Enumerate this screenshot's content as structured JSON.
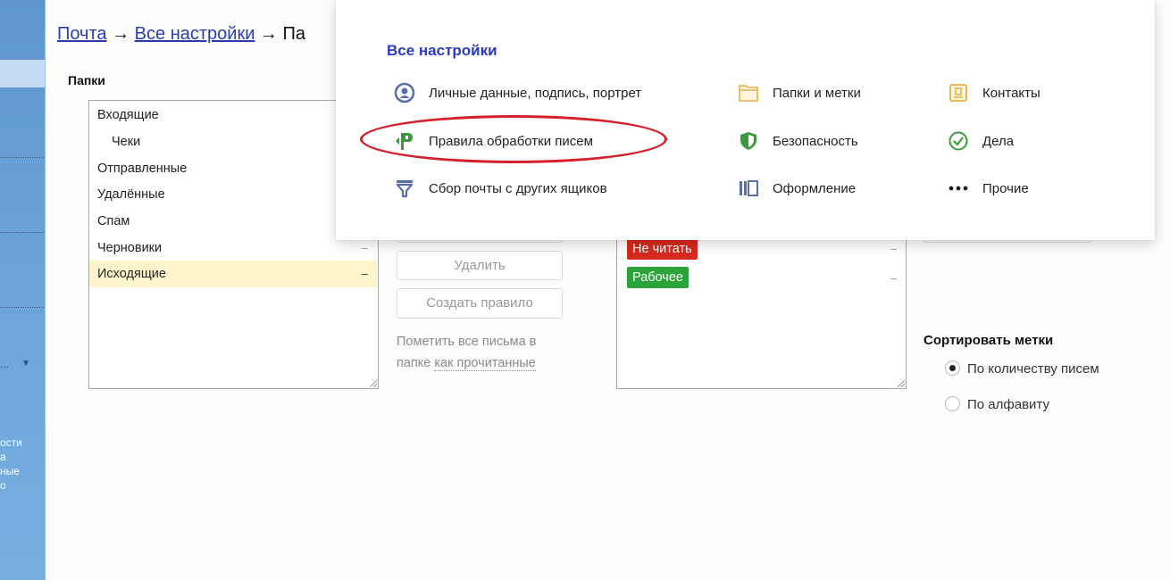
{
  "sidebar": {
    "texts": [
      "...",
      "ости",
      "а",
      "ные",
      "о"
    ],
    "dropdown_icon": "triangle-down-icon"
  },
  "breadcrumb": {
    "link1": "Почта",
    "arrow": "→",
    "link2": "Все настройки",
    "current": "Па"
  },
  "folders": {
    "title": "Папки",
    "items": [
      {
        "label": "Входящие",
        "sub": false,
        "active": false,
        "dash": ""
      },
      {
        "label": "Чеки",
        "sub": true,
        "active": false,
        "dash": ""
      },
      {
        "label": "Отправленные",
        "sub": false,
        "active": false,
        "dash": ""
      },
      {
        "label": "Удалённые",
        "sub": false,
        "active": false,
        "dash": ""
      },
      {
        "label": "Спам",
        "sub": false,
        "active": false,
        "dash": ""
      },
      {
        "label": "Черновики",
        "sub": false,
        "active": false,
        "dash": "–"
      },
      {
        "label": "Исходящие",
        "sub": false,
        "active": true,
        "dash": "–"
      }
    ]
  },
  "actions": {
    "delete": "Удалить",
    "create_rule": "Создать правило",
    "mark_note_1": "Пометить все письма в",
    "mark_note_2": "папке",
    "mark_note_link": "как прочитанные"
  },
  "labels": {
    "items": [
      {
        "label": "Не читать",
        "color": "#d62a1e",
        "dash": "–"
      },
      {
        "label": "Рабочее",
        "color": "#2aa43a",
        "dash": "–"
      }
    ]
  },
  "sort": {
    "title": "Сортировать метки",
    "options": [
      {
        "label": "По количеству писем",
        "checked": true
      },
      {
        "label": "По алфавиту",
        "checked": false
      }
    ]
  },
  "settings_menu": {
    "title": "Все настройки",
    "items": [
      {
        "label": "Личные данные, подпись, портрет",
        "icon": "user-circle-icon"
      },
      {
        "label": "Правила обработки писем",
        "icon": "rules-icon"
      },
      {
        "label": "Сбор почты с других ящиков",
        "icon": "funnel-icon"
      },
      {
        "label": "Папки и метки",
        "icon": "folder-icon"
      },
      {
        "label": "Безопасность",
        "icon": "shield-icon"
      },
      {
        "label": "Оформление",
        "icon": "theme-icon"
      },
      {
        "label": "Контакты",
        "icon": "contacts-icon"
      },
      {
        "label": "Дела",
        "icon": "check-circle-icon"
      },
      {
        "label": "Прочие",
        "icon": "more-dots-icon"
      }
    ]
  },
  "colors": {
    "link": "#2a3eab",
    "menu_title": "#2b3ac1",
    "highlight": "#d4202a",
    "active_row": "#fff5cc"
  }
}
